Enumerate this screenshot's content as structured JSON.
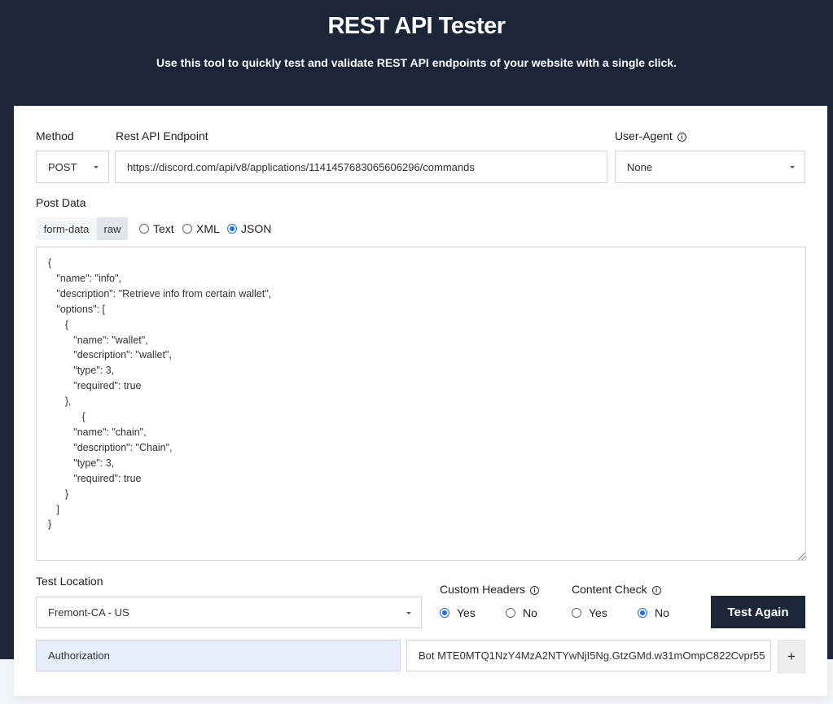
{
  "header": {
    "title": "REST API Tester",
    "subtitle": "Use this tool to quickly test and validate REST API endpoints of your website with a single click."
  },
  "form": {
    "method": {
      "label": "Method",
      "value": "POST",
      "icon": "chevron-down-icon"
    },
    "endpoint": {
      "label": "Rest API Endpoint",
      "value": "https://discord.com/api/v8/applications/1141457683065606296/commands"
    },
    "user_agent": {
      "label": "User-Agent",
      "info_icon": "info-icon",
      "value": "None"
    },
    "post_data": {
      "label": "Post Data",
      "tabs": [
        {
          "label": "form-data",
          "active": false
        },
        {
          "label": "raw",
          "active": true
        }
      ],
      "formats": [
        {
          "label": "Text",
          "selected": false
        },
        {
          "label": "XML",
          "selected": false
        },
        {
          "label": "JSON",
          "selected": true
        }
      ],
      "body": "{\n   \"name\": \"info\",\n   \"description\": \"Retrieve info from certain wallet\",\n   \"options\": [\n      {\n         \"name\": \"wallet\",\n         \"description\": \"wallet\",\n         \"type\": 3,\n         \"required\": true\n      },\n            {\n         \"name\": \"chain\",\n         \"description\": \"Chain\",\n         \"type\": 3,\n         \"required\": true\n      }\n   ]\n}"
    },
    "test_location": {
      "label": "Test Location",
      "value": "Fremont-CA - US"
    },
    "custom_headers": {
      "label": "Custom Headers",
      "options": [
        {
          "label": "Yes",
          "selected": true
        },
        {
          "label": "No",
          "selected": false
        }
      ]
    },
    "content_check": {
      "label": "Content Check",
      "options": [
        {
          "label": "Yes",
          "selected": false
        },
        {
          "label": "No",
          "selected": true
        }
      ]
    },
    "submit_label": "Test Again",
    "header_row": {
      "name": "Authorization",
      "value": "Bot MTE0MTQ1NzY4MzA2NTYwNjI5Ng.GtzGMd.w31mOmpC822Cvpr55",
      "add_label": "+"
    }
  },
  "colors": {
    "brand_dark": "#1b2638",
    "accent": "#1a73e8",
    "header_key_bg": "#e8effc"
  }
}
